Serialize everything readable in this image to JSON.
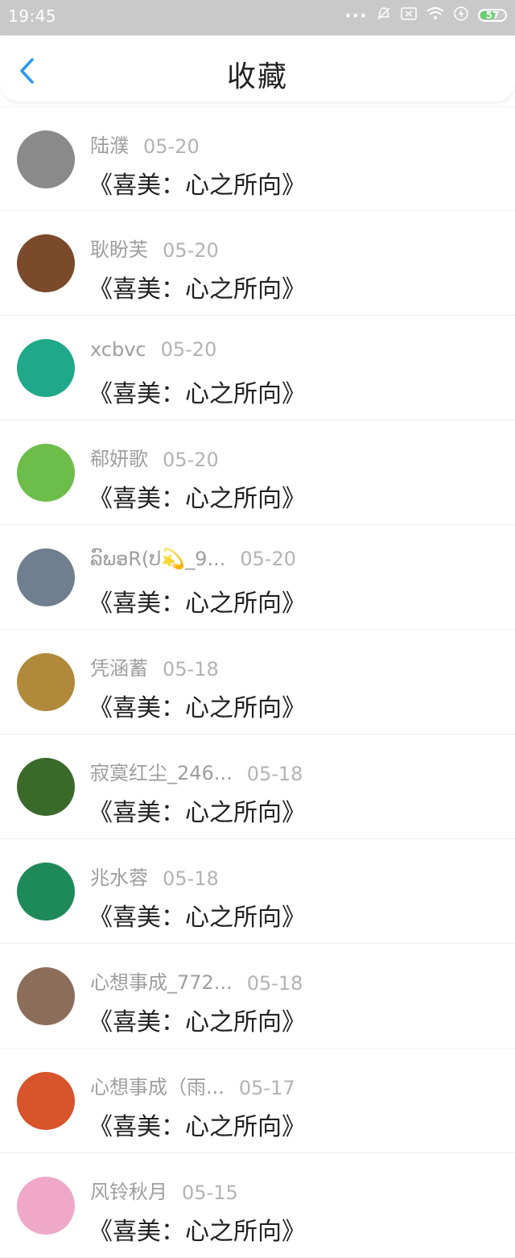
{
  "status": {
    "time": "19:45",
    "battery": "57",
    "icons": [
      "dots-icon",
      "mute-bell-icon",
      "sim-icon",
      "wifi-icon",
      "charging-icon",
      "battery-icon"
    ]
  },
  "header": {
    "back_icon": "chevron-left-icon",
    "title": "收藏"
  },
  "items": [
    {
      "name": "陆濮",
      "date": "05-20",
      "title": "《喜美：心之所向》",
      "avatar_color": "#8a8a8a"
    },
    {
      "name": "耿盼芙",
      "date": "05-20",
      "title": "《喜美：心之所向》",
      "avatar_color": "#7a4a2a"
    },
    {
      "name": "xcbvc",
      "date": "05-20",
      "title": "《喜美：心之所向》",
      "avatar_color": "#1fa88a"
    },
    {
      "name": "郗妍歌",
      "date": "05-20",
      "title": "《喜美：心之所向》",
      "avatar_color": "#6cbd4a"
    },
    {
      "name": "ລົພອR(ປ💫_9...",
      "date": "05-20",
      "title": "《喜美：心之所向》",
      "avatar_color": "#6f7f8f"
    },
    {
      "name": "凭涵蓄",
      "date": "05-18",
      "title": "《喜美：心之所向》",
      "avatar_color": "#b08a3a"
    },
    {
      "name": "寂寞红尘_246...",
      "date": "05-18",
      "title": "《喜美：心之所向》",
      "avatar_color": "#3a6a2a"
    },
    {
      "name": "兆水蓉",
      "date": "05-18",
      "title": "《喜美：心之所向》",
      "avatar_color": "#1e8a5a"
    },
    {
      "name": "心想事成_772...",
      "date": "05-18",
      "title": "《喜美：心之所向》",
      "avatar_color": "#8c6d5a"
    },
    {
      "name": "心想事成（雨...",
      "date": "05-17",
      "title": "《喜美：心之所向》",
      "avatar_color": "#d8542a"
    },
    {
      "name": "风铃秋月",
      "date": "05-15",
      "title": "《喜美：心之所向》",
      "avatar_color": "#f0a8c8"
    }
  ]
}
